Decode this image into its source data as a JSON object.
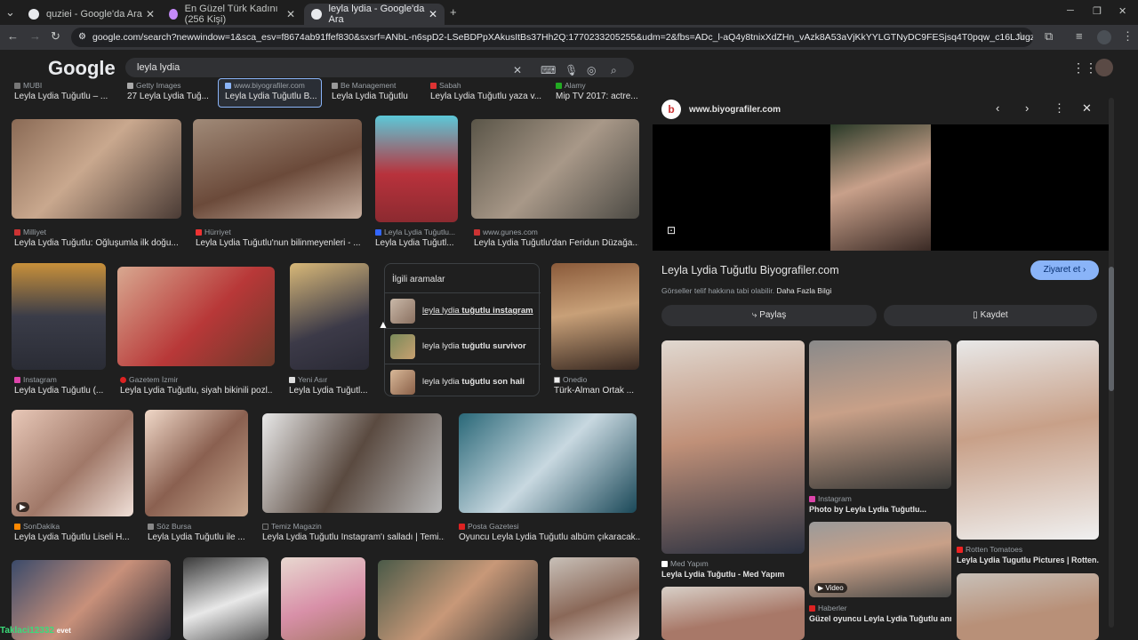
{
  "tabs": [
    {
      "title": "quziei - Google'da Ara"
    },
    {
      "title": "En Güzel Türk Kadını (256 Kişi)"
    },
    {
      "title": "leyla lydia - Google'da Ara"
    }
  ],
  "url": "google.com/search?newwindow=1&sca_esv=f8674ab91ffef830&sxsrf=ANbL-n6spD2-LSeBDPpXAkusItBs37Hh2Q:1770233205255&udm=2&fbs=ADc_l-aQ4y8tnixXdZHn_vAzk8A53aVjKkYYLGTNyDC9FESjsq4T0pqw_c16LJugzmuYavcaBHrszESmJswAtT...",
  "logo": "Google",
  "query": "leyla lydia",
  "top_row": [
    {
      "src": "MUBI",
      "title": "Leyla Lydia Tuğutlu – ..."
    },
    {
      "src": "Getty Images",
      "title": "27 Leyla Lydia Tuğ..."
    },
    {
      "src": "www.biyografiler.com",
      "title": "Leyla Lydia Tuğutlu B..."
    },
    {
      "src": "Be Management",
      "title": "Leyla Lydia Tuğutlu"
    },
    {
      "src": "Sabah",
      "title": "Leyla Lydia Tuğutlu yaza v..."
    },
    {
      "src": "Alamy",
      "title": "Mip TV 2017: actre..."
    }
  ],
  "row1": [
    {
      "src": "Milliyet",
      "title": "Leyla Lydia Tuğutlu: Oğluşumla ilk doğu..."
    },
    {
      "src": "Hürriyet",
      "title": "Leyla Lydia Tuğutlu'nun bilinmeyenleri - ..."
    },
    {
      "src": "Leyla Lydia Tuğutlu...",
      "title": "Leyla Lydia Tuğutl..."
    },
    {
      "src": "www.gunes.com",
      "title": "Leyla Lydia Tuğutlu'dan Feridun Düzağa..."
    }
  ],
  "row2": [
    {
      "src": "Instagram",
      "title": "Leyla Lydia Tuğutlu (..."
    },
    {
      "src": "Gazetem İzmir",
      "title": "Leyla Lydia Tuğutlu, siyah bikinili pozl..."
    },
    {
      "src": "Yeni Asır",
      "title": "Leyla Lydia Tuğutl..."
    },
    {
      "src": "Onedio",
      "title": "Türk-Alman Ortak ..."
    }
  ],
  "related": {
    "heading": "İlgili aramalar",
    "items": [
      {
        "pre": "leyla lydia ",
        "bold": "tuğutlu instagram"
      },
      {
        "pre": "leyla lydia ",
        "bold": "tuğutlu survivor"
      },
      {
        "pre": "leyla lydia ",
        "bold": "tuğutlu son hali"
      }
    ]
  },
  "row3": [
    {
      "src": "SonDakika",
      "title": "Leyla Lydia Tuğutlu Liseli H..."
    },
    {
      "src": "Söz Bursa",
      "title": "Leyla Lydia Tuğutlu ile ..."
    },
    {
      "src": "Temiz Magazin",
      "title": "Leyla Lydia Tuğutlu Instagram'ı salladı | Temi..."
    },
    {
      "src": "Posta Gazetesi",
      "title": "Oyuncu Leyla Lydia Tuğutlu albüm çıkaracak..."
    }
  ],
  "panel": {
    "site": "www.biyografiler.com",
    "title": "Leyla Lydia Tuğutlu Biyografiler.com",
    "visit": "Ziyaret et",
    "copyright": "Görseller telif hakkına tabi olabilir.",
    "more": "Daha Fazla Bilgi",
    "share": "Paylaş",
    "save": "Kaydet",
    "results": [
      {
        "src": "Med Yapım",
        "title": "Leyla Lydia Tuğutlu - Med Yapım"
      },
      {
        "src": "Instagram",
        "title": "Photo by Leyla Lydia Tuğutlu..."
      },
      {
        "src": "Rotten Tomatoes",
        "title": "Leyla Lydia Tugutlu Pictures | Rotten..."
      },
      {
        "src": "Haberler",
        "title": "Güzel oyuncu Leyla Lydia Tuğutlu anne..."
      }
    ],
    "video_badge": "Video"
  },
  "taskbar": {
    "user": "Taklaci12332",
    "extra": "evet"
  }
}
